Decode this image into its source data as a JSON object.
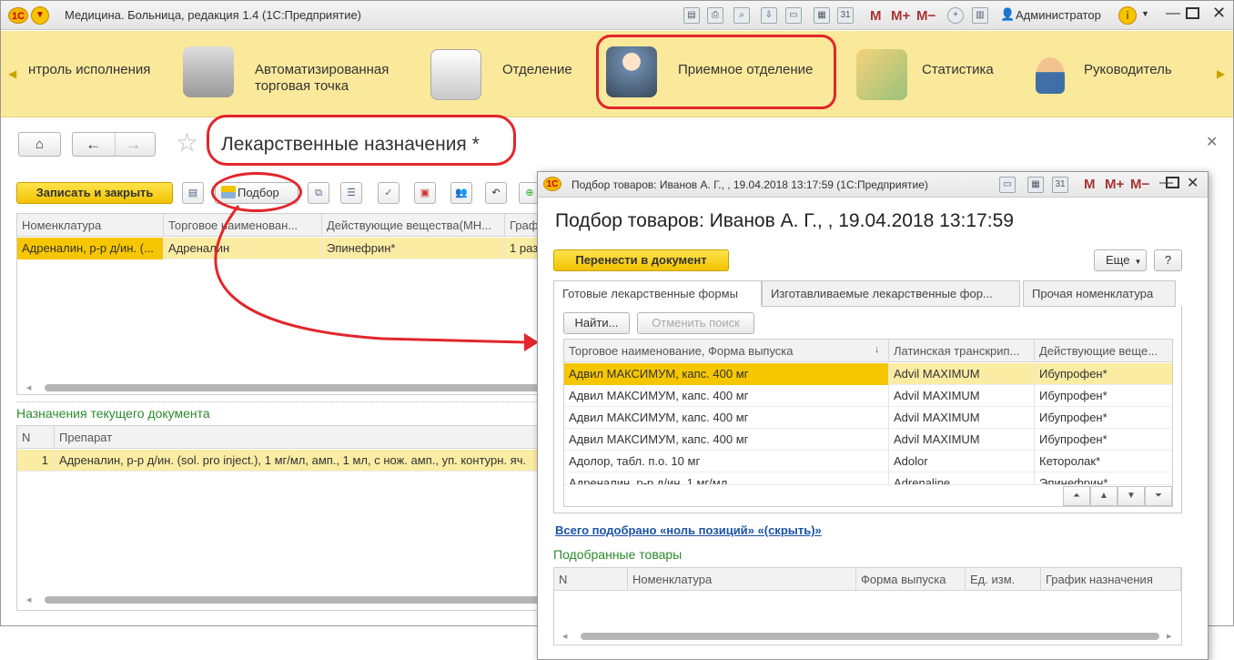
{
  "app": {
    "title": "Медицина. Больница, редакция 1.4  (1С:Предприятие)",
    "user": "Администратор",
    "m_buttons": [
      "M",
      "M+",
      "M−"
    ],
    "calendar_day": "31"
  },
  "sections": [
    {
      "label": "нтроль исполнения"
    },
    {
      "label": "Автоматизированная",
      "label2": "торговая точка"
    },
    {
      "label": "Отделение"
    },
    {
      "label": "Приемное отделение"
    },
    {
      "label": "Статистика"
    },
    {
      "label": "Руководитель"
    }
  ],
  "form": {
    "title": "Лекарственные назначения *",
    "save_close": "Записать и закрыть",
    "pick": "Подбор"
  },
  "top_grid": {
    "columns": [
      "Номенклатура",
      "Торговое наименован...",
      "Действующие вещества(МН...",
      "Граф"
    ],
    "rows": [
      [
        "Адреналин, р-р д/ин. (...",
        "Адреналин",
        "Эпинефрин*",
        "1 раз"
      ]
    ]
  },
  "bottom": {
    "title": "Назначения текущего документа",
    "columns": [
      "N",
      "Препарат"
    ],
    "rows": [
      [
        "1",
        "Адреналин, р-р д/ин. (sol. pro inject.), 1 мг/мл, амп., 1 мл, с нож. амп., уп. контурн. яч."
      ]
    ]
  },
  "dialog": {
    "title": "Подбор товаров: Иванов А. Г., , 19.04.2018 13:17:59  (1С:Предприятие)",
    "heading": "Подбор товаров: Иванов А. Г., , 19.04.2018 13:17:59",
    "transfer": "Перенести в документ",
    "more": "Еще",
    "help": "?",
    "tabs": [
      "Готовые лекарственные формы",
      "Изготавливаемые лекарственные фор...",
      "Прочая номенклатура"
    ],
    "find": "Найти...",
    "cancel_find": "Отменить поиск",
    "columns": [
      "Торговое наименование, Форма выпуска",
      "Латинская транскрип...",
      "Действующие веще..."
    ],
    "rows": [
      [
        "Адвил МАКСИМУМ, капс. 400 мг",
        "Advil MAXIMUM",
        "Ибупрофен*"
      ],
      [
        "Адвил МАКСИМУМ, капс. 400 мг",
        "Advil MAXIMUM",
        "Ибупрофен*"
      ],
      [
        "Адвил МАКСИМУМ, капс. 400 мг",
        "Advil MAXIMUM",
        "Ибупрофен*"
      ],
      [
        "Адвил МАКСИМУМ, капс. 400 мг",
        "Advil MAXIMUM",
        "Ибупрофен*"
      ],
      [
        "Адолор, табл. п.о. 10 мг",
        "Adolor",
        "Кеторолак*"
      ],
      [
        "Адреналин, р-р д/ин. 1 мг/мл",
        "Adrenaline",
        "Эпинефрин*"
      ]
    ],
    "summary": "Всего подобрано «ноль позиций» «(скрыть)»",
    "picked_title": "Подобранные товары",
    "picked_columns": [
      "N",
      "Номенклатура",
      "Форма выпуска",
      "Ед. изм.",
      "График назначения"
    ]
  }
}
